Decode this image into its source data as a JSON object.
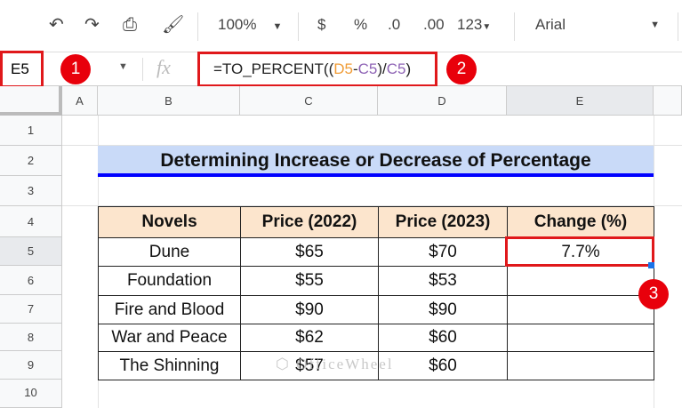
{
  "toolbar": {
    "zoom": "100%",
    "currency": "$",
    "percent": "%",
    "decrease_decimal": ".0",
    "increase_decimal": ".00",
    "format": "123",
    "font": "Arial"
  },
  "formula_bar": {
    "cell_ref": "E5",
    "fx": "fx",
    "formula_prefix": "=TO_PERCENT((",
    "ref1": "D5",
    "minus": "-",
    "ref2": "C5",
    "mid": ")/",
    "ref3": "C5",
    "suffix": ")"
  },
  "badges": [
    "1",
    "2",
    "3"
  ],
  "columns": [
    "A",
    "B",
    "C",
    "D",
    "E"
  ],
  "rows": [
    "1",
    "2",
    "3",
    "4",
    "5",
    "6",
    "7",
    "8",
    "9",
    "10"
  ],
  "title": "Determining Increase or Decrease of Percentage",
  "table": {
    "headers": [
      "Novels",
      "Price (2022)",
      "Price (2023)",
      "Change (%)"
    ],
    "rows": [
      [
        "Dune",
        "$65",
        "$70",
        "7.7%"
      ],
      [
        "Foundation",
        "$55",
        "$53",
        ""
      ],
      [
        "Fire and Blood",
        "$90",
        "$90",
        ""
      ],
      [
        "War and Peace",
        "$62",
        "$60",
        ""
      ],
      [
        "The Shinning",
        "$57",
        "$60",
        ""
      ]
    ]
  },
  "watermark": "OfficeWheel",
  "colors": {
    "accent_red": "#e0181b",
    "header_fill": "#fce5cd",
    "title_fill": "#c9daf8",
    "title_underline": "#0000ff",
    "selection": "#1a73e8"
  }
}
